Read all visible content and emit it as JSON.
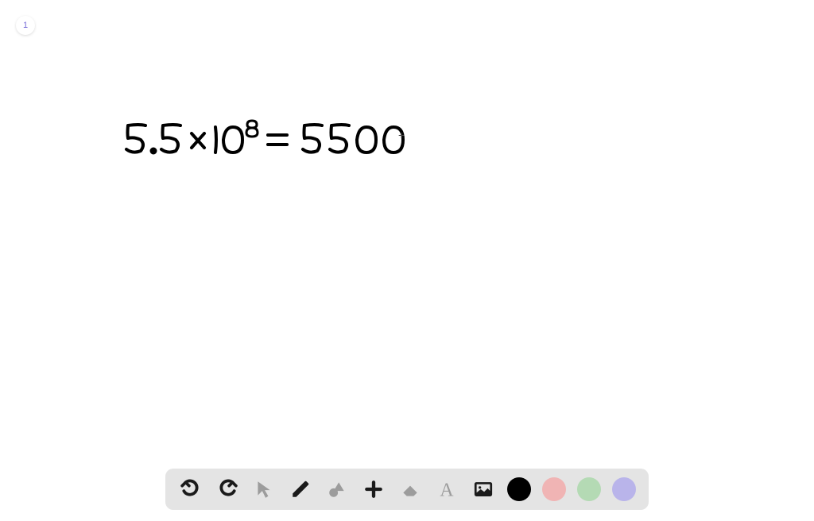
{
  "page": {
    "number": "1"
  },
  "canvas": {
    "handwritten_text": "5.5 × 10⁸ = 5500",
    "cursor_symbol": "+"
  },
  "toolbar": {
    "tools": {
      "undo": "undo",
      "redo": "redo",
      "select": "select",
      "pen": "pen",
      "shapes": "shapes",
      "add": "add",
      "eraser": "eraser",
      "text": "text",
      "image": "image"
    },
    "colors": {
      "black": "#000000",
      "pink": "#f0b4b4",
      "green": "#b4dab4",
      "purple": "#b9b4ea"
    }
  }
}
